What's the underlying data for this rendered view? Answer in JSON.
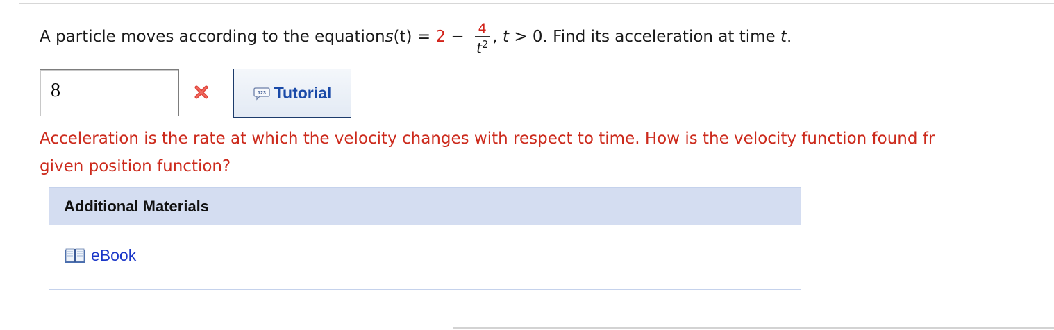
{
  "question": {
    "prefix": "A particle moves according to the equation ",
    "func_name": "s",
    "func_arg": "(t)",
    "equals": " = ",
    "constant": "2",
    "minus": " − ",
    "frac_num": "4",
    "frac_den_var": "t",
    "frac_den_exp": "2",
    "after_frac": ",",
    "cond_var": "t",
    "cond_rest": " > 0. Find its acceleration at time ",
    "end_var": "t",
    "end_punct": "."
  },
  "answer": {
    "value": "8",
    "status_icon": "red-x-icon"
  },
  "tutorial": {
    "icon": "tutorial-123-icon",
    "label": "Tutorial"
  },
  "feedback": {
    "line1": "Acceleration is the rate at which the velocity changes with respect to time. How is the velocity function found fr",
    "line2": "given position function?"
  },
  "additional_materials": {
    "title": "Additional Materials",
    "items": [
      {
        "icon": "book-icon",
        "label": "eBook"
      }
    ]
  },
  "colors": {
    "highlight_red": "#d2231a",
    "feedback_red": "#cc2a1c",
    "link_blue": "#1a36c8",
    "panel_header": "#d4ddf1"
  }
}
